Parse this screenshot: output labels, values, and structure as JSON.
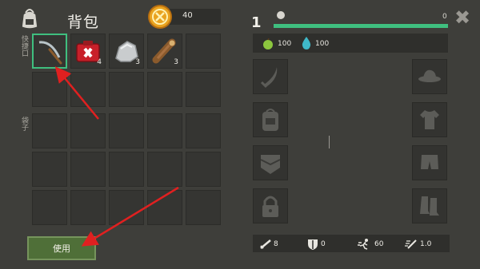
{
  "header": {
    "title": "背包",
    "coins": "40"
  },
  "labels": {
    "quick_slot": "快捷口",
    "bag_slot": "袋子"
  },
  "inventory": {
    "quick_items": [
      {
        "name": "scythe",
        "count": ""
      },
      {
        "name": "medkit",
        "count": "4"
      },
      {
        "name": "stone",
        "count": "3"
      },
      {
        "name": "wood-log",
        "count": "3"
      }
    ]
  },
  "use_button": "使用",
  "player": {
    "level": "1",
    "xp": "0",
    "xp_fraction": 1.0
  },
  "resources": {
    "food": "100",
    "water": "100"
  },
  "stats": {
    "attack": "8",
    "defense": "0",
    "speed": "60",
    "speed_multiplier": "1.0"
  },
  "colors": {
    "accent": "#3fbf7f",
    "button": "#4f6f38",
    "panel": "#3e3e3a",
    "arrow": "#e02020"
  }
}
